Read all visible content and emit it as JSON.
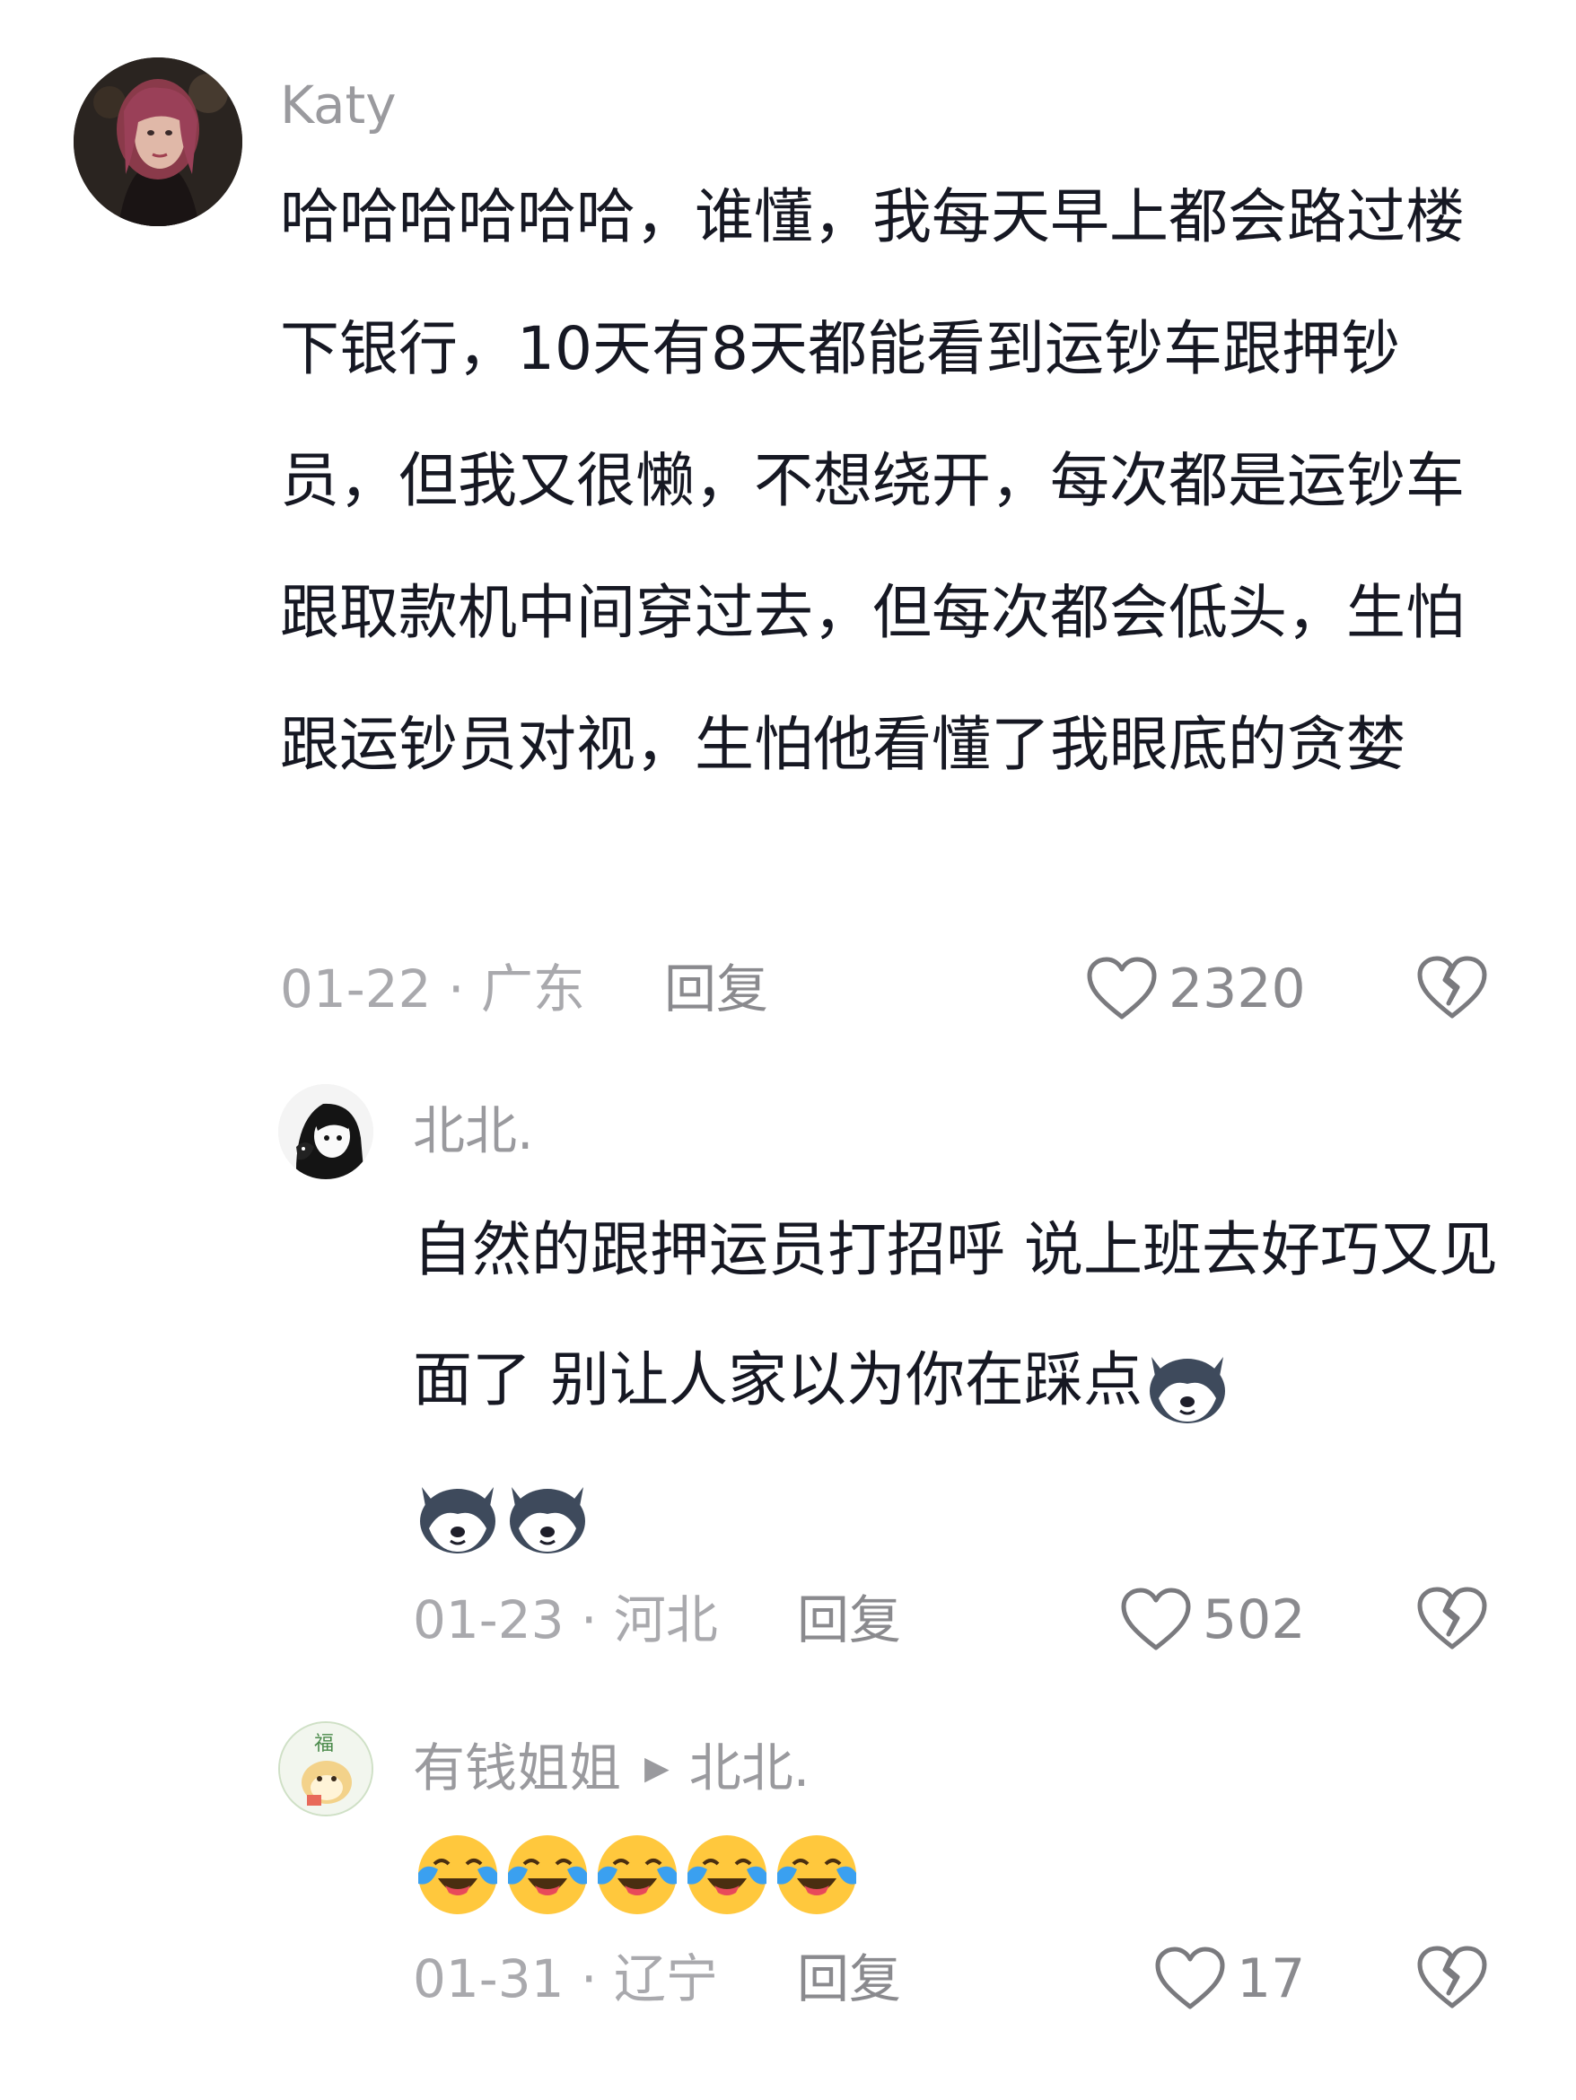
{
  "comments": [
    {
      "author": "Katy",
      "text": "哈哈哈哈哈哈，谁懂，我每天早上都会路过楼下银行，10天有8天都能看到运钞车跟押钞员，但我又很懒，不想绕开，每次都是运钞车跟取款机中间穿过去，但每次都会低头，生怕跟运钞员对视，生怕他看懂了我眼底的贪婪",
      "date_location": "01-22 · 广东",
      "reply_label": "回复",
      "likes": "2320",
      "avatar_icon": "woman-portrait-avatar"
    },
    {
      "author": "北北.",
      "text": "自然的跟押运员打招呼 说上班去好巧又见面了 别让人家以为你在踩点",
      "emojis": [
        "husky-emoji",
        "husky-emoji",
        "husky-emoji"
      ],
      "date_location": "01-23 · 河北",
      "reply_label": "回复",
      "likes": "502",
      "avatar_icon": "anime-girl-avatar"
    },
    {
      "author": "有钱姐姐",
      "reply_to": "北北.",
      "text": "",
      "emojis": [
        "tears-of-joy-emoji",
        "tears-of-joy-emoji",
        "tears-of-joy-emoji",
        "tears-of-joy-emoji",
        "tears-of-joy-emoji"
      ],
      "date_location": "01-31 · 辽宁",
      "reply_label": "回复",
      "likes": "17",
      "avatar_icon": "cartoon-cat-avatar"
    }
  ],
  "colors": {
    "text": "#161823",
    "secondary": "#9a9a9e",
    "background": "#ffffff"
  }
}
